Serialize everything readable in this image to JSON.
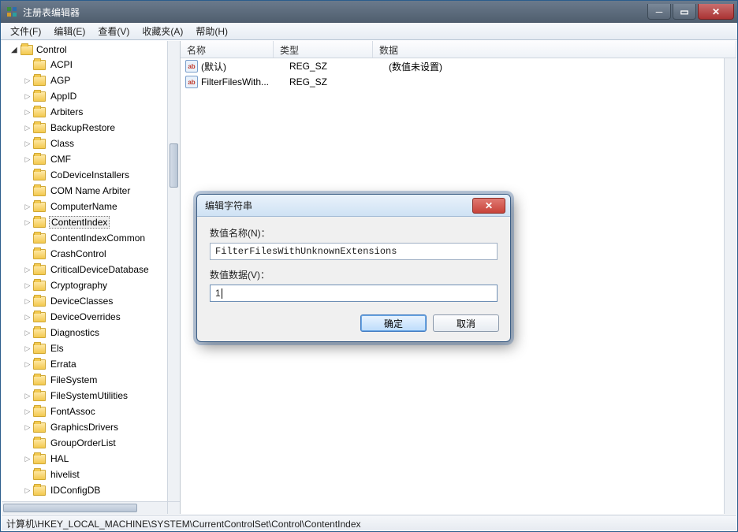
{
  "window": {
    "title": "注册表编辑器"
  },
  "menu": {
    "file": "文件(F)",
    "edit": "编辑(E)",
    "view": "查看(V)",
    "fav": "收藏夹(A)",
    "help": "帮助(H)"
  },
  "tree": {
    "root": "Control",
    "items": [
      {
        "label": "ACPI",
        "expandable": false
      },
      {
        "label": "AGP",
        "expandable": true
      },
      {
        "label": "AppID",
        "expandable": true
      },
      {
        "label": "Arbiters",
        "expandable": true
      },
      {
        "label": "BackupRestore",
        "expandable": true
      },
      {
        "label": "Class",
        "expandable": true
      },
      {
        "label": "CMF",
        "expandable": true
      },
      {
        "label": "CoDeviceInstallers",
        "expandable": false
      },
      {
        "label": "COM Name Arbiter",
        "expandable": false
      },
      {
        "label": "ComputerName",
        "expandable": true
      },
      {
        "label": "ContentIndex",
        "expandable": true,
        "selected": true
      },
      {
        "label": "ContentIndexCommon",
        "expandable": false
      },
      {
        "label": "CrashControl",
        "expandable": false
      },
      {
        "label": "CriticalDeviceDatabase",
        "expandable": true
      },
      {
        "label": "Cryptography",
        "expandable": true
      },
      {
        "label": "DeviceClasses",
        "expandable": true
      },
      {
        "label": "DeviceOverrides",
        "expandable": true
      },
      {
        "label": "Diagnostics",
        "expandable": true
      },
      {
        "label": "Els",
        "expandable": true
      },
      {
        "label": "Errata",
        "expandable": true
      },
      {
        "label": "FileSystem",
        "expandable": false
      },
      {
        "label": "FileSystemUtilities",
        "expandable": true
      },
      {
        "label": "FontAssoc",
        "expandable": true
      },
      {
        "label": "GraphicsDrivers",
        "expandable": true
      },
      {
        "label": "GroupOrderList",
        "expandable": false
      },
      {
        "label": "HAL",
        "expandable": true
      },
      {
        "label": "hivelist",
        "expandable": false
      },
      {
        "label": "IDConfigDB",
        "expandable": true
      }
    ]
  },
  "list": {
    "cols": {
      "name": "名称",
      "type": "类型",
      "data": "数据"
    },
    "rows": [
      {
        "name": "(默认)",
        "type": "REG_SZ",
        "data": "(数值未设置)"
      },
      {
        "name": "FilterFilesWith...",
        "type": "REG_SZ",
        "data": ""
      }
    ]
  },
  "status": {
    "path": "计算机\\HKEY_LOCAL_MACHINE\\SYSTEM\\CurrentControlSet\\Control\\ContentIndex"
  },
  "dialog": {
    "title": "编辑字符串",
    "name_label": "数值名称(N)：",
    "name_value": "FilterFilesWithUnknownExtensions",
    "data_label": "数值数据(V)：",
    "data_value": "1",
    "ok": "确定",
    "cancel": "取消"
  }
}
